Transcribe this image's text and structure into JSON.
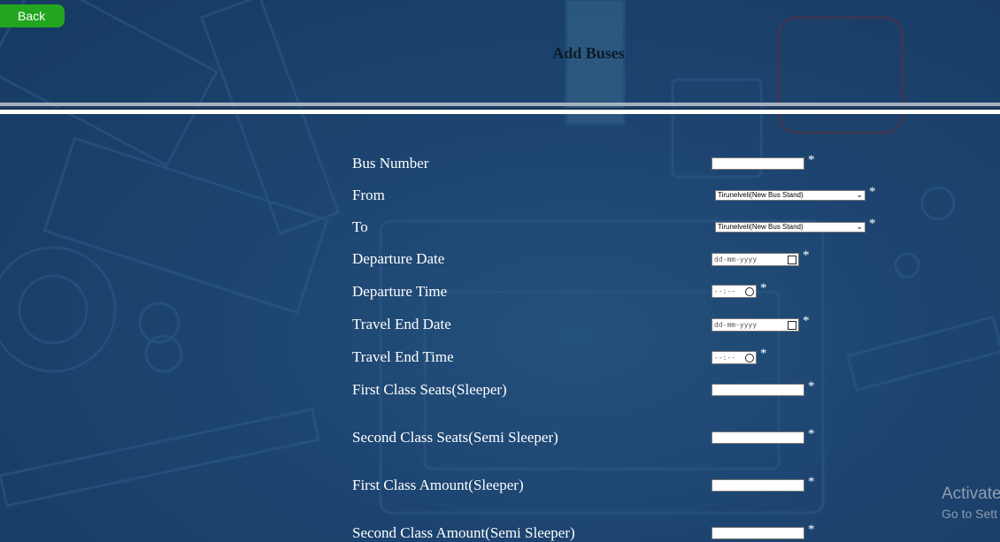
{
  "back_label": "Back",
  "title": "Add Buses",
  "required_mark": "*",
  "fields": {
    "bus_number": {
      "label": "Bus Number",
      "value": ""
    },
    "from": {
      "label": "From",
      "value": "Tirunelveli(New Bus Stand)"
    },
    "to": {
      "label": "To",
      "value": "Tirunelveli(New Bus Stand)"
    },
    "departure_date": {
      "label": "Departure Date",
      "placeholder": "dd-mm-yyyy"
    },
    "departure_time": {
      "label": "Departure Time",
      "placeholder": "--:--"
    },
    "travel_end_date": {
      "label": "Travel End Date",
      "placeholder": "dd-mm-yyyy"
    },
    "travel_end_time": {
      "label": "Travel End Time",
      "placeholder": "--:--"
    },
    "first_class_seats": {
      "label": "First Class Seats(Sleeper)",
      "value": ""
    },
    "second_class_seats": {
      "label": "Second Class Seats(Semi Sleeper)",
      "value": ""
    },
    "first_class_amount": {
      "label": "First Class Amount(Sleeper)",
      "value": ""
    },
    "second_class_amount": {
      "label": "Second Class Amount(Semi Sleeper)",
      "value": ""
    }
  },
  "watermark": {
    "line1": "Activate",
    "line2": "Go to Sett"
  },
  "colors": {
    "background": "#1d4470",
    "back_button": "#22a61f",
    "label_text": "#ffffff"
  }
}
